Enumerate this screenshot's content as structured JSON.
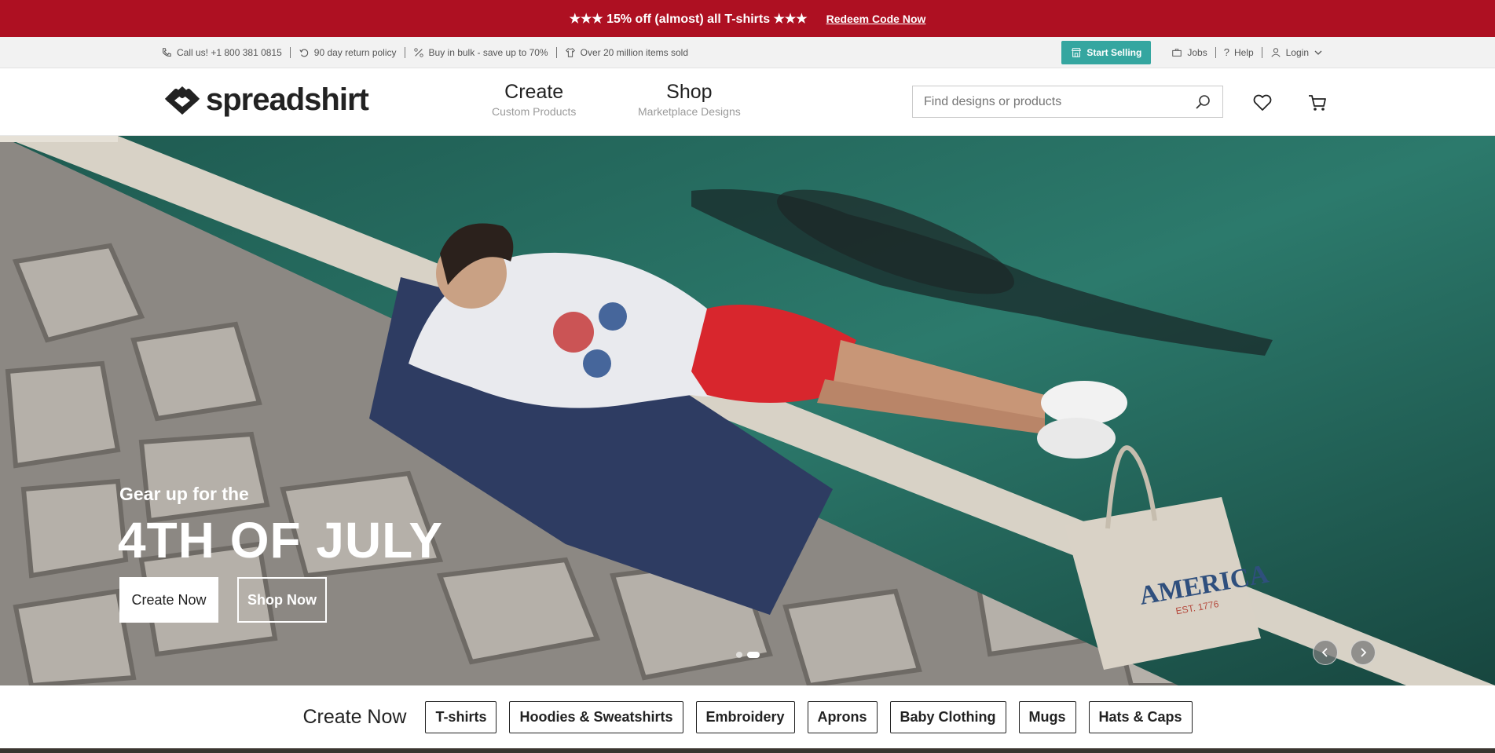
{
  "promo": {
    "message": "★★★ 15% off (almost) all T-shirts ★★★",
    "link": "Redeem Code Now"
  },
  "infobar": {
    "items": [
      {
        "icon": "phone-icon",
        "label": "Call us! +1 800 381 0815"
      },
      {
        "icon": "return-icon",
        "label": "90 day return policy"
      },
      {
        "icon": "percent-icon",
        "label": "Buy in bulk - save up to 70%"
      },
      {
        "icon": "shirt-icon",
        "label": "Over 20 million items sold"
      }
    ],
    "start_selling": "Start Selling",
    "jobs": "Jobs",
    "help": "Help",
    "login": "Login"
  },
  "header": {
    "logo": "spreadshirt",
    "nav": [
      {
        "title": "Create",
        "subtitle": "Custom Products"
      },
      {
        "title": "Shop",
        "subtitle": "Marketplace Designs"
      }
    ],
    "search_placeholder": "Find designs or products"
  },
  "hero": {
    "subtitle": "Gear up for the",
    "title": "4TH OF JULY",
    "create_button": "Create Now",
    "shop_button": "Shop Now",
    "bag_text": "AMERICA",
    "bag_subtext": "EST. 1776",
    "slide_count": 2,
    "active_slide": 2
  },
  "categories": {
    "title": "Create Now",
    "chips": [
      "T-shirts",
      "Hoodies & Sweatshirts",
      "Embroidery",
      "Aprons",
      "Baby Clothing",
      "Mugs",
      "Hats & Caps"
    ]
  },
  "colors": {
    "promo_bg": "#ae1022",
    "accent_teal": "#35a6a0"
  }
}
